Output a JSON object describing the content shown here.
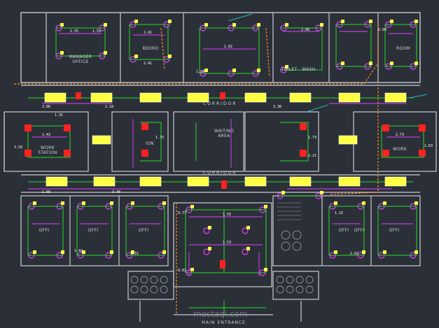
{
  "plan": {
    "rooms": {
      "manager_office": "MANAGER OFFICE",
      "bedroom": "BEDRO",
      "toilet": "TOILET",
      "wash": "WASH",
      "work_station_left": "WORK STATION",
      "waiting_area": "WAITING AREA",
      "work_station_right": "WORK",
      "office_1": "OFFI",
      "office_2": "OFFI",
      "office_3": "OFFI",
      "office_4": "OFFI",
      "office_5": "OFFI",
      "office_6": "OFFI",
      "room_mid": "ION",
      "room_top": "ROOM"
    },
    "corridor_top": "CORRIDOR",
    "corridor_mid": "CORRIDOR",
    "main_entrance": "MAIN ENTRANCE",
    "watermark": "mostaqi.com"
  },
  "dimensions": {
    "values": [
      "1.55",
      "1.52",
      "2.41",
      "2.41",
      "1.62",
      "3.86",
      "2.18",
      "3.38",
      "2.43",
      "3.59",
      "1.75",
      "1.73",
      "2.21",
      "2.73",
      "2.63",
      "1.88",
      "3.48",
      "0.77",
      "1.55",
      "1.53",
      "0.81",
      "1.18",
      "1.31",
      "1.15",
      "2.09",
      "2.08",
      "2.15",
      "2.62",
      "1.42"
    ]
  },
  "colors": {
    "background": "#2b2f38",
    "wall": "#c9ccd2",
    "circuit": "#22dd22",
    "dim": "#e040ff",
    "luminaire": "#ffff44",
    "panel": "#ff2222",
    "orange": "#ff8c1a",
    "cyan": "#22e0e0"
  }
}
